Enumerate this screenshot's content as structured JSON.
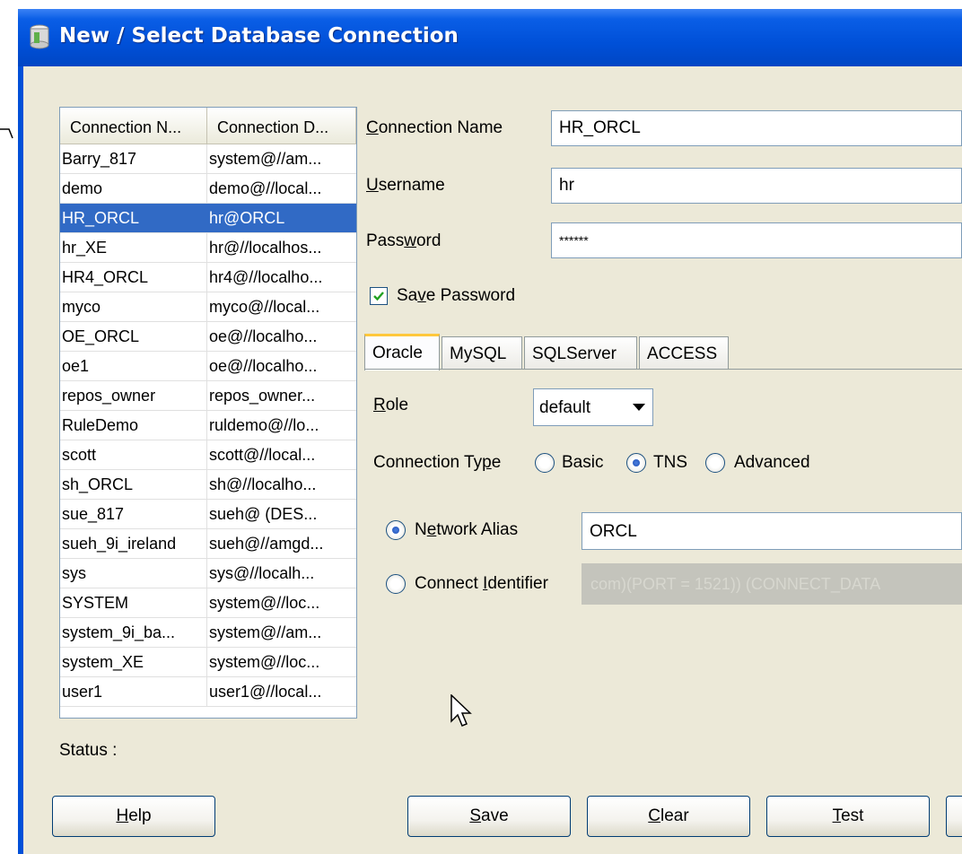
{
  "window": {
    "title": "New / Select Database Connection"
  },
  "connections_table": {
    "headers": [
      "Connection N...",
      "Connection D..."
    ],
    "rows": [
      {
        "name": "Barry_817",
        "details": "system@//am..."
      },
      {
        "name": "demo",
        "details": "demo@//local..."
      },
      {
        "name": "HR_ORCL",
        "details": "hr@ORCL",
        "selected": true
      },
      {
        "name": "hr_XE",
        "details": "hr@//localhos..."
      },
      {
        "name": "HR4_ORCL",
        "details": "hr4@//localho..."
      },
      {
        "name": "myco",
        "details": "myco@//local..."
      },
      {
        "name": "OE_ORCL",
        "details": "oe@//localho..."
      },
      {
        "name": "oe1",
        "details": "oe@//localho..."
      },
      {
        "name": "repos_owner",
        "details": "repos_owner..."
      },
      {
        "name": "RuleDemo",
        "details": "ruldemo@//lo..."
      },
      {
        "name": "scott",
        "details": "scott@//local..."
      },
      {
        "name": "sh_ORCL",
        "details": "sh@//localho..."
      },
      {
        "name": "sue_817",
        "details": "sueh@ (DES..."
      },
      {
        "name": "sueh_9i_ireland",
        "details": "sueh@//amgd..."
      },
      {
        "name": "sys",
        "details": "sys@//localh..."
      },
      {
        "name": "SYSTEM",
        "details": "system@//loc..."
      },
      {
        "name": "system_9i_ba...",
        "details": "system@//am..."
      },
      {
        "name": "system_XE",
        "details": "system@//loc..."
      },
      {
        "name": "user1",
        "details": "user1@//local..."
      }
    ]
  },
  "status": {
    "label": "Status :"
  },
  "form": {
    "connection_name": {
      "label_pre": "",
      "label_key": "C",
      "label_post": "onnection Name",
      "value": "HR_ORCL"
    },
    "username": {
      "label_pre": "",
      "label_key": "U",
      "label_post": "sername",
      "value": "hr"
    },
    "password": {
      "label_pre": "Pass",
      "label_key": "w",
      "label_post": "ord",
      "value": "******"
    },
    "save_password": {
      "label_pre": "Sa",
      "label_key": "v",
      "label_post": "e Password",
      "checked": true
    }
  },
  "tabs": [
    {
      "label": "Oracle",
      "active": true
    },
    {
      "label": "MySQL"
    },
    {
      "label": "SQLServer"
    },
    {
      "label": "ACCESS"
    }
  ],
  "oracle": {
    "role": {
      "label_pre": "",
      "label_key": "R",
      "label_post": "ole",
      "value": "default"
    },
    "connection_type": {
      "label_pre": "Connection Ty",
      "label_key": "p",
      "label_post": "e",
      "options": {
        "basic": "Basic",
        "tns": "TNS",
        "advanced": "Advanced"
      },
      "selected": "TNS"
    },
    "network_alias": {
      "label_pre": "N",
      "label_key": "e",
      "label_post": "twork Alias",
      "value": "ORCL",
      "selected": true
    },
    "connect_identifier": {
      "label_pre": "Connect ",
      "label_key": "I",
      "label_post": "dentifier",
      "value": "com)(PORT = 1521)) (CONNECT_DATA"
    }
  },
  "buttons": {
    "help": {
      "pre": "",
      "key": "H",
      "post": "elp"
    },
    "save": {
      "pre": "",
      "key": "S",
      "post": "ave"
    },
    "clear": {
      "pre": "",
      "key": "C",
      "post": "lear"
    },
    "test": {
      "pre": "",
      "key": "T",
      "post": "est"
    }
  },
  "colors": {
    "title_bar": "#0050d8",
    "selection": "#316ac5",
    "client_bg": "#ece9d8"
  }
}
